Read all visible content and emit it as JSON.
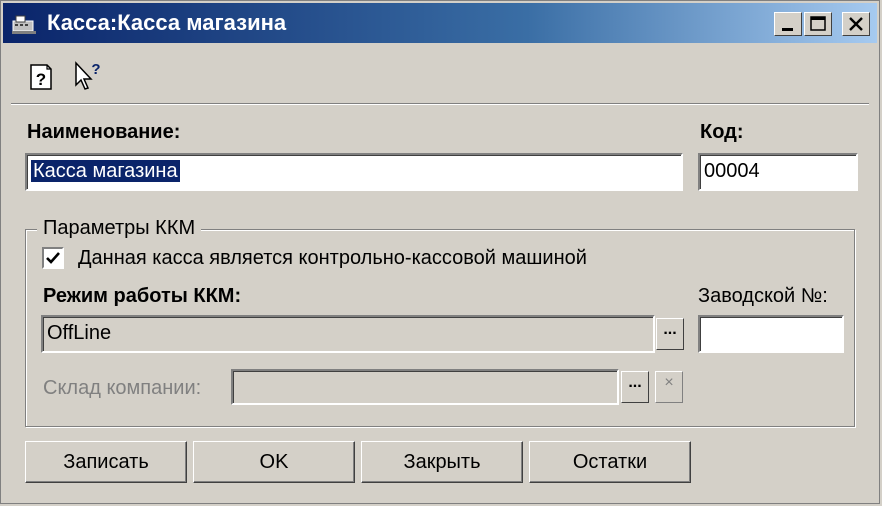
{
  "window": {
    "title": "Касса:Касса магазина",
    "minimize_icon": "minimize-icon",
    "maximize_icon": "maximize-icon",
    "close_icon": "close-icon"
  },
  "toolbar": {
    "items": [
      {
        "icon": "help-document-icon"
      },
      {
        "icon": "whats-this-pointer-icon"
      }
    ]
  },
  "form": {
    "name_label": "Наименование:",
    "name_value": "Касса магазина",
    "code_label": "Код:",
    "code_value": "00004",
    "group_title": "Параметры ККМ",
    "is_kkm_label": "Данная касса является контрольно-кассовой машиной",
    "is_kkm_checked": true,
    "mode_label": "Режим работы ККМ:",
    "mode_value": "OffLine",
    "serial_label": "Заводской №:",
    "serial_value": "",
    "warehouse_label": "Склад компании:",
    "warehouse_value": "",
    "select_button_label": "...",
    "clear_button_label": "×"
  },
  "buttons": {
    "save": "Записать",
    "ok": "OK",
    "close": "Закрыть",
    "balances": "Остатки"
  }
}
